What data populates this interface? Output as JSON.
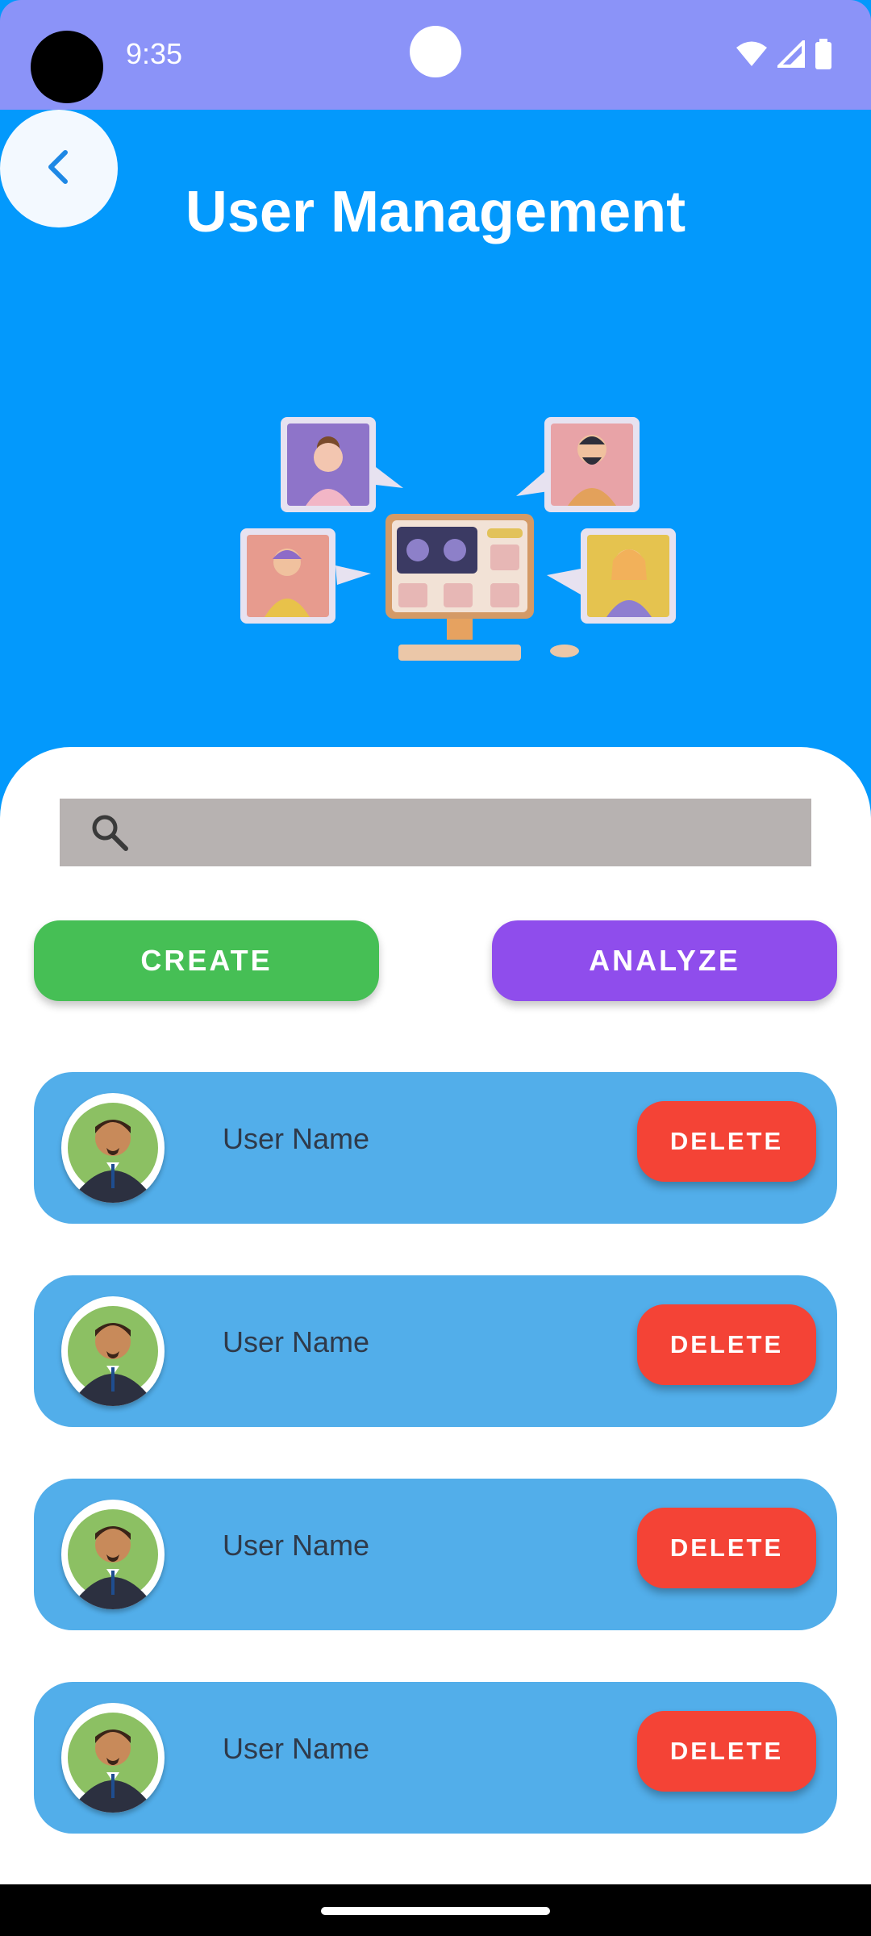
{
  "status_bar": {
    "time": "9:35",
    "icons": [
      "wifi-icon",
      "signal-icon",
      "battery-icon"
    ]
  },
  "header": {
    "back_icon": "chevron-left-icon",
    "title": "User Management"
  },
  "search": {
    "icon": "search-icon",
    "value": "",
    "placeholder": ""
  },
  "actions": {
    "create_label": "CREATE",
    "analyze_label": "ANALYZE"
  },
  "users": [
    {
      "name": "User Name",
      "delete_label": "DELETE"
    },
    {
      "name": "User Name",
      "delete_label": "DELETE"
    },
    {
      "name": "User Name",
      "delete_label": "DELETE"
    },
    {
      "name": "User Name",
      "delete_label": "DELETE"
    }
  ],
  "colors": {
    "status_bar": "#8B93F8",
    "header_bg": "#0399FC",
    "create": "#46BF55",
    "analyze": "#8F4DEC",
    "row": "#52AEEA",
    "delete": "#F44336",
    "search_bg": "#B7B2B1"
  }
}
